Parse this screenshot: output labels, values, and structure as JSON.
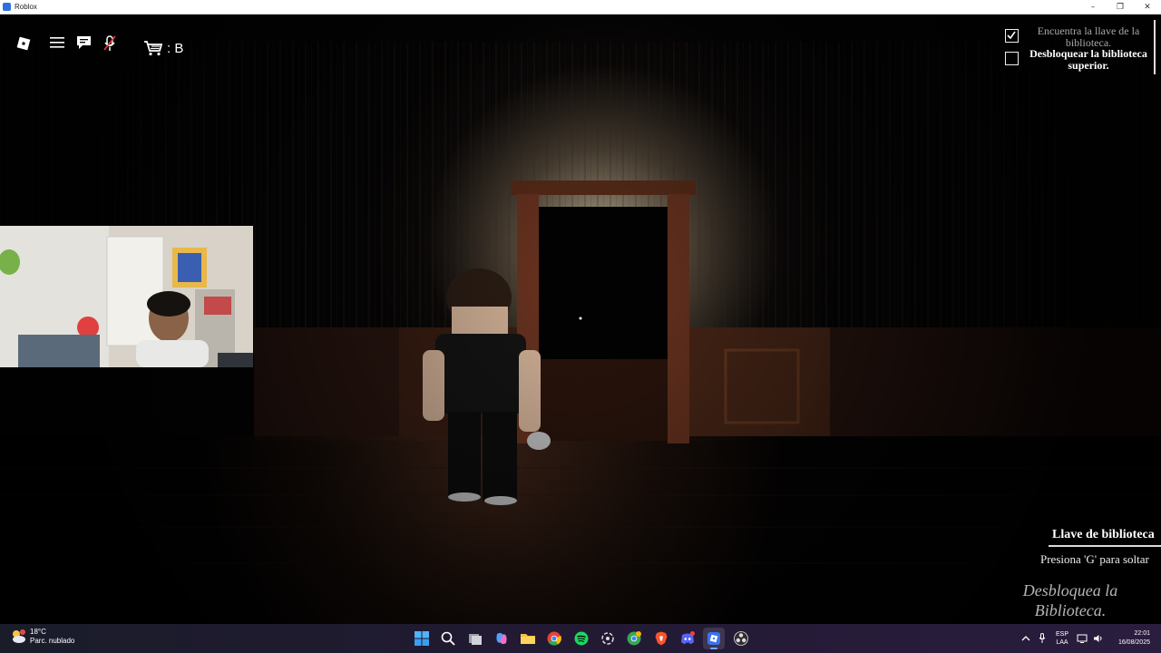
{
  "window": {
    "title": "Roblox",
    "minimize_glyph": "–",
    "maximize_glyph": "❐",
    "close_glyph": "✕"
  },
  "hud": {
    "cart_label": ": B",
    "icons": [
      "roblox-logo-icon",
      "hamburger-menu-icon",
      "chat-icon",
      "microphone-muted-icon",
      "cart-icon"
    ]
  },
  "objectives": [
    {
      "text": "Encuentra la llave de la biblioteca.",
      "completed": true
    },
    {
      "text": "Desbloquear la biblioteca superior.",
      "completed": false
    }
  ],
  "tool": {
    "name": "Llave de biblioteca",
    "hint": "Presiona 'G' para soltar"
  },
  "task_hint": "Desbloquea la Biblioteca.",
  "taskbar": {
    "weather_temp": "18°C",
    "weather_desc": "Parc. nublado",
    "apps": [
      "windows-start-icon",
      "search-icon",
      "task-view-icon",
      "copilot-icon",
      "file-explorer-icon",
      "chrome-icon",
      "spotify-icon",
      "chatgpt-icon",
      "chrome-profile-icon",
      "brave-icon",
      "discord-icon",
      "roblox-icon",
      "obs-icon"
    ],
    "active_app": "roblox-icon",
    "lang_line1": "ESP",
    "lang_line2": "LAA",
    "time": "22:01",
    "date": "16/08/2025"
  },
  "colors": {
    "taskbar_bg": "#221a33",
    "completed_objective": "#a9a9a9",
    "pending_objective": "#ffffff"
  }
}
